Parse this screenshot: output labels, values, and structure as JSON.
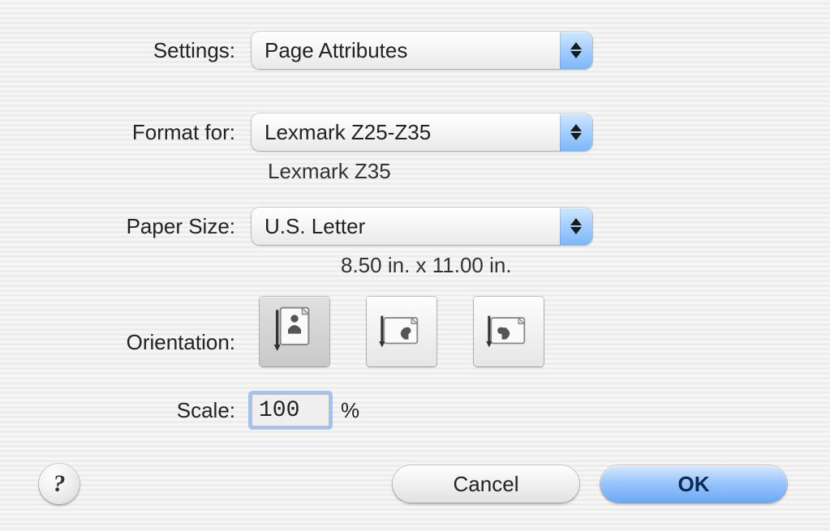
{
  "labels": {
    "settings": "Settings:",
    "format_for": "Format for:",
    "paper_size": "Paper Size:",
    "orientation": "Orientation:",
    "scale": "Scale:",
    "scale_suffix": "%"
  },
  "settings": {
    "selected": "Page Attributes"
  },
  "format_for": {
    "selected": "Lexmark Z25-Z35",
    "sublabel": "Lexmark Z35"
  },
  "paper_size": {
    "selected": "U.S. Letter",
    "sublabel": "8.50 in. x 11.00 in."
  },
  "orientation": {
    "selected_index": 0,
    "icons": [
      "orientation-portrait-icon",
      "orientation-landscape-left-icon",
      "orientation-landscape-right-icon"
    ]
  },
  "scale": {
    "value": "100"
  },
  "buttons": {
    "help": "?",
    "cancel": "Cancel",
    "ok": "OK"
  }
}
